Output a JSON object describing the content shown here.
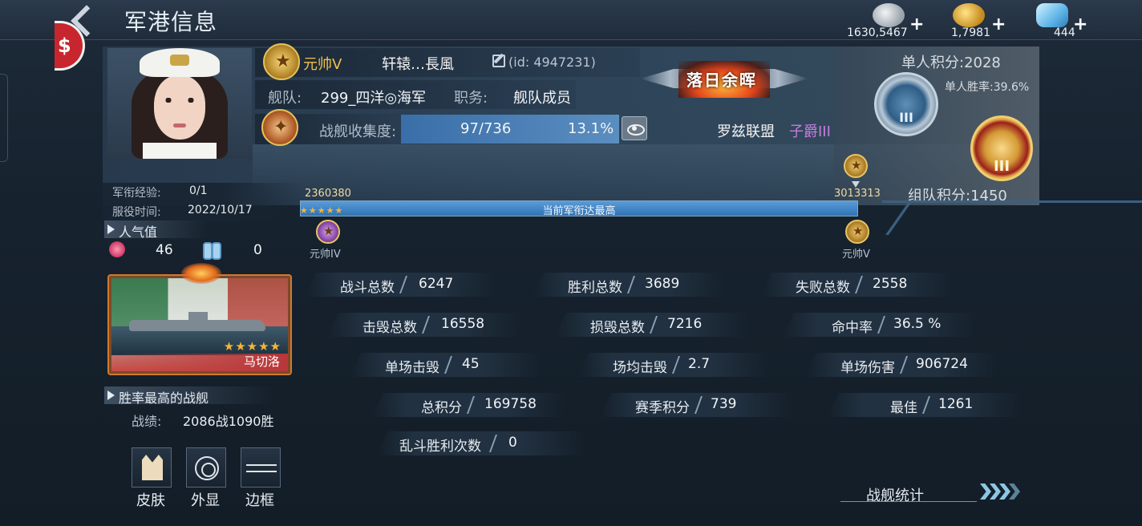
{
  "header": {
    "title": "军港信息",
    "back_icon": "back-arrow-icon",
    "currencies": [
      {
        "name": "silver",
        "value": "1630,5467",
        "icon": "silver-coins-icon"
      },
      {
        "name": "gold",
        "value": "1,7981",
        "icon": "gold-coins-icon"
      },
      {
        "name": "diamond",
        "value": "444",
        "icon": "diamond-icon"
      }
    ],
    "plus": "+"
  },
  "profile": {
    "rank": "元帅V",
    "name": "轩辕…長風",
    "id": "(id: 4947231)",
    "fleet_label": "舰队:",
    "fleet_value": "299_四洋◎海军",
    "duty_label": "职务:",
    "duty_value": "舰队成员",
    "collection_label": "战舰收集度:",
    "collection_value": "97/736",
    "collection_pct": "13.1%",
    "title_banner": "落日余晖",
    "alliance": "罗兹联盟",
    "alliance_rank": "子爵III"
  },
  "scores": {
    "solo_score": "单人积分:2028",
    "solo_rate": "单人胜率:39.6%",
    "team_score": "组队积分:1450",
    "silver_medal_tier": "III",
    "gold_medal_tier": "III"
  },
  "experience": {
    "exp_label": "军衔经验:",
    "exp_value": "0/1",
    "service_label": "服役时间:",
    "service_value": "2022/10/17",
    "progress_text": "当前军衔达最高",
    "progress_fraction": 1.0,
    "stars": "★★★★★",
    "start_value": "2360380",
    "end_value": "3013313",
    "start_rank": "元帅IV",
    "end_rank": "元帅V",
    "colors": {
      "progress": "#3d86c8",
      "gold": "#f2c14a",
      "purple_rank": "#c67be0"
    }
  },
  "popularity": {
    "title": "人气值",
    "rose_count": "46",
    "flip_count": "0"
  },
  "best_ship": {
    "name": "马切洛",
    "stars": "★★★★★",
    "section_title": "胜率最高的战舰",
    "record_label": "战绩:",
    "record_value": "2086战1090胜"
  },
  "buttons": {
    "skin": "皮肤",
    "appearance": "外显",
    "frame": "边框"
  },
  "stats": [
    {
      "label": "战斗总数",
      "value": "6247"
    },
    {
      "label": "胜利总数",
      "value": "3689"
    },
    {
      "label": "失败总数",
      "value": "2558"
    },
    {
      "label": "击毁总数",
      "value": "16558"
    },
    {
      "label": "损毁总数",
      "value": "7216"
    },
    {
      "label": "命中率",
      "value": "36.5 %"
    },
    {
      "label": "单场击毁",
      "value": "45"
    },
    {
      "label": "场均击毁",
      "value": "2.7"
    },
    {
      "label": "单场伤害",
      "value": "906724"
    },
    {
      "label": "总积分",
      "value": "169758"
    },
    {
      "label": "赛季积分",
      "value": "739"
    },
    {
      "label": "最佳",
      "value": "1261"
    },
    {
      "label": "乱斗胜利次数",
      "value": "0"
    }
  ],
  "ship_stats_link": "战舰统计"
}
